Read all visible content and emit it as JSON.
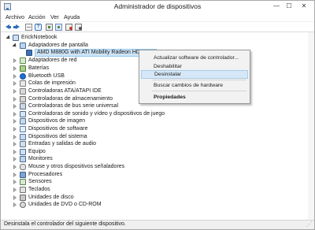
{
  "window": {
    "title": "Administrador de dispositivos",
    "controls": {
      "minimize": "—",
      "maximize": "☐",
      "close": "✕"
    }
  },
  "menubar": {
    "items": [
      "Archivo",
      "Acción",
      "Ver",
      "Ayuda"
    ]
  },
  "toolbar": {
    "icons": [
      "back-arrow-icon",
      "forward-arrow-icon",
      "device-grid-icon",
      "help-icon",
      "properties-icon",
      "scan-hardware-icon",
      "uninstall-icon",
      "disable-icon"
    ]
  },
  "tree": {
    "root": "ErickNotebook",
    "items": [
      {
        "label": "Adaptadores de pantalla",
        "icon": "display-adapter-icon",
        "expanded": true
      },
      {
        "label": "AMD M880G with ATI Mobility Radeon HD 4250",
        "icon": "gpu-icon",
        "child": true,
        "selected": true
      },
      {
        "label": "Adaptadores de red",
        "icon": "network-adapter-icon"
      },
      {
        "label": "Baterías",
        "icon": "battery-icon"
      },
      {
        "label": "Bluetooth USB",
        "icon": "bluetooth-icon"
      },
      {
        "label": "Colas de impresión",
        "icon": "print-queue-icon"
      },
      {
        "label": "Controladoras ATA/ATAPI IDE",
        "icon": "ide-controller-icon"
      },
      {
        "label": "Controladoras de almacenamiento",
        "icon": "storage-controller-icon"
      },
      {
        "label": "Controladoras de bus serie universal",
        "icon": "usb-controller-icon"
      },
      {
        "label": "Controladoras de sonido y vídeo y dispositivos de juego",
        "icon": "sound-video-icon"
      },
      {
        "label": "Dispositivos de imagen",
        "icon": "imaging-device-icon"
      },
      {
        "label": "Dispositivos de software",
        "icon": "software-device-icon"
      },
      {
        "label": "Dispositivos del sistema",
        "icon": "system-device-icon"
      },
      {
        "label": "Entradas y salidas de audio",
        "icon": "audio-io-icon"
      },
      {
        "label": "Equipo",
        "icon": "computer-icon"
      },
      {
        "label": "Monitores",
        "icon": "monitor-icon"
      },
      {
        "label": "Mouse y otros dispositivos señaladores",
        "icon": "mouse-icon"
      },
      {
        "label": "Procesadores",
        "icon": "processor-icon"
      },
      {
        "label": "Sensores",
        "icon": "sensor-icon"
      },
      {
        "label": "Teclados",
        "icon": "keyboard-icon"
      },
      {
        "label": "Unidades de disco",
        "icon": "disk-drive-icon"
      },
      {
        "label": "Unidades de DVD o CD-ROM",
        "icon": "dvd-drive-icon"
      }
    ]
  },
  "context_menu": {
    "items": [
      {
        "label": "Actualizar software de controlador...",
        "highlight": false,
        "bold": false
      },
      {
        "label": "Deshabilitar",
        "highlight": false,
        "bold": false
      },
      {
        "label": "Desinstalar",
        "highlight": true,
        "bold": false
      },
      {
        "separator": true
      },
      {
        "label": "Buscar cambios de hardware",
        "highlight": false,
        "bold": false
      },
      {
        "separator": true
      },
      {
        "label": "Propiedades",
        "highlight": false,
        "bold": true
      }
    ]
  },
  "statusbar": {
    "text": "Desinstala el controlador del siguiente dispositivo."
  },
  "colors": {
    "selection": "#cce4f7",
    "menu_highlight": "#d6e8f7",
    "menu_background": "#f2f2f2"
  }
}
